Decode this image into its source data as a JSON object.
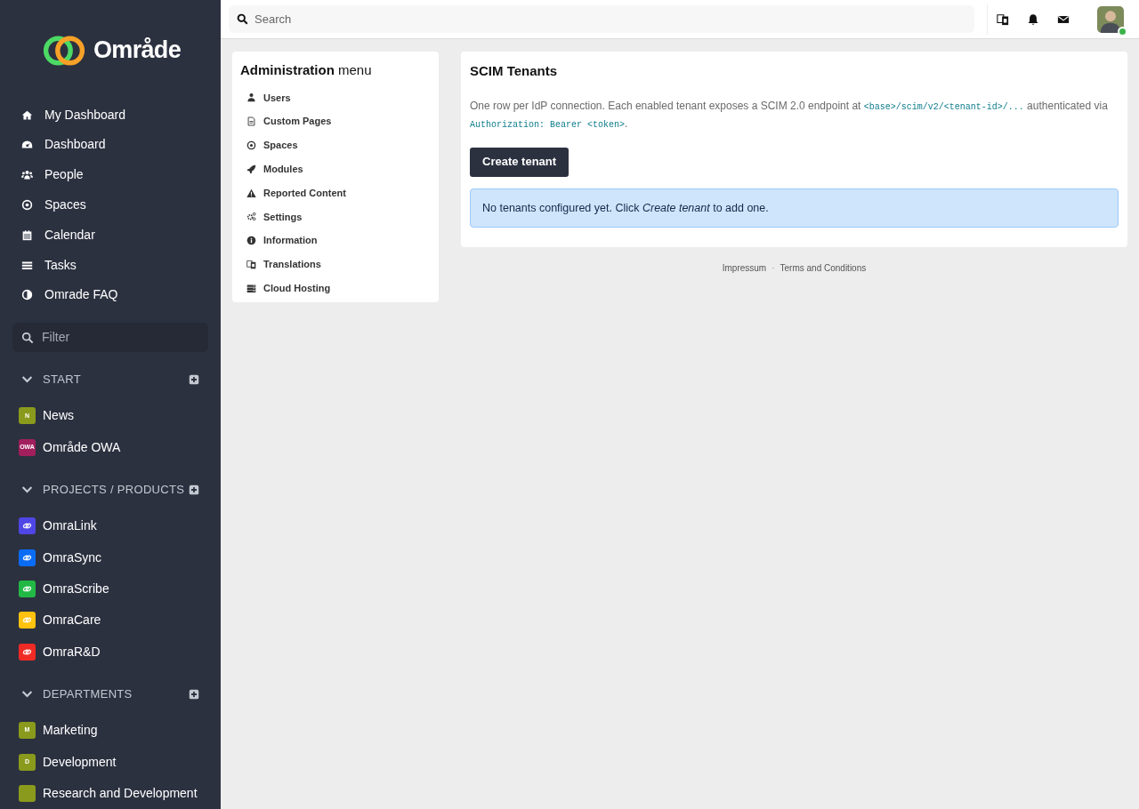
{
  "brand": {
    "name": "Område"
  },
  "nav": [
    {
      "label": "My Dashboard"
    },
    {
      "label": "Dashboard"
    },
    {
      "label": "People"
    },
    {
      "label": "Spaces"
    },
    {
      "label": "Calendar"
    },
    {
      "label": "Tasks"
    },
    {
      "label": "Omrade FAQ"
    }
  ],
  "filter": {
    "placeholder": "Filter"
  },
  "sections": [
    {
      "title": "START",
      "expanded": true,
      "items": [
        {
          "label": "News",
          "kind": "letter",
          "initials": "N",
          "color": "#8a9a1c"
        },
        {
          "label": "Område OWA",
          "kind": "letter",
          "initials": "OWA",
          "color": "#a21f5e"
        }
      ]
    },
    {
      "title": "PROJECTS / PRODUCTS",
      "expanded": true,
      "items": [
        {
          "label": "OmraLink",
          "kind": "product",
          "color": "#4f46e5"
        },
        {
          "label": "OmraSync",
          "kind": "product",
          "color": "#0a6cf5"
        },
        {
          "label": "OmraScribe",
          "kind": "product",
          "color": "#22b845"
        },
        {
          "label": "OmraCare",
          "kind": "product",
          "color": "#ffc20e"
        },
        {
          "label": "OmraR&D",
          "kind": "product",
          "color": "#f02a24"
        }
      ]
    },
    {
      "title": "DEPARTMENTS",
      "expanded": true,
      "items": [
        {
          "label": "Marketing",
          "kind": "letter",
          "initials": "M",
          "color": "#8a9a1c"
        },
        {
          "label": "Development",
          "kind": "letter",
          "initials": "D",
          "color": "#8a9a1c"
        },
        {
          "label": "Research and Development",
          "kind": "letter",
          "color": "#8a9a1c"
        }
      ]
    }
  ],
  "topbar": {
    "search": {
      "placeholder": "Search"
    },
    "user": {
      "online": true
    }
  },
  "admin_menu": {
    "title": "**Administration** menu",
    "items": [
      {
        "label": "Users"
      },
      {
        "label": "Custom Pages"
      },
      {
        "label": "Spaces"
      },
      {
        "label": "Modules"
      },
      {
        "label": "Reported Content"
      },
      {
        "label": "Settings"
      },
      {
        "label": "Information"
      },
      {
        "label": "Translations"
      },
      {
        "label": "Cloud Hosting"
      }
    ]
  },
  "panel": {
    "title": "SCIM Tenants",
    "description": [
      {
        "kind": "text",
        "text": "One row per IdP connection. Each enabled tenant exposes a SCIM 2.0 endpoint at "
      },
      {
        "kind": "code",
        "text": "<base>/scim/v2/<tenant-id>/..."
      },
      {
        "kind": "text",
        "text": " authenticated via "
      },
      {
        "kind": "code",
        "text": "Authorization: Bearer <token>"
      },
      {
        "kind": "text",
        "text": "."
      }
    ],
    "button": "Create tenant",
    "notice": "No tenants configured yet. Click *Create tenant* to add one."
  },
  "footer": [
    "Impressum",
    "·",
    "Terms and Conditions"
  ]
}
